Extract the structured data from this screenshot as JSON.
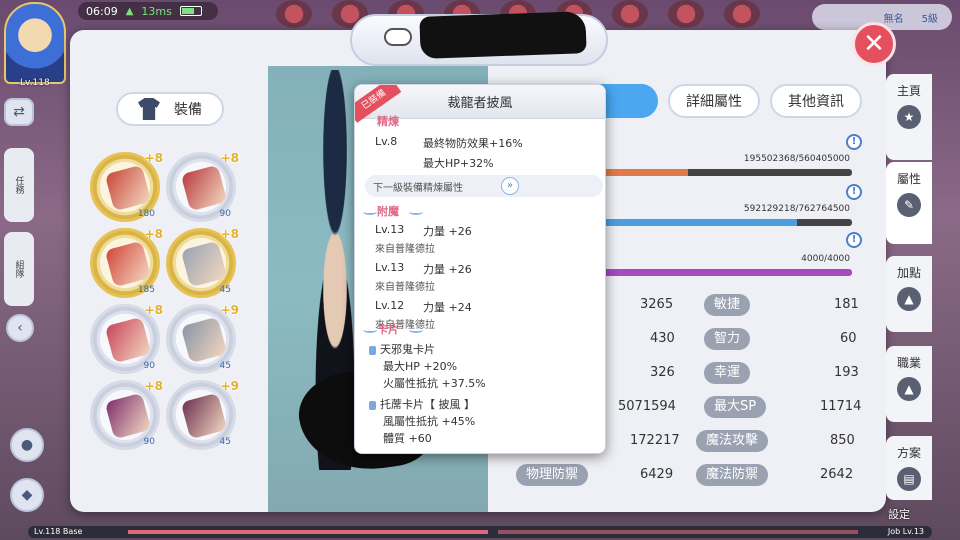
{
  "hud": {
    "avatar_level": "Lv.118",
    "time": "06:09",
    "latency": "13ms",
    "top_right_name": "無名",
    "top_right_tag": "5級"
  },
  "left_side": {
    "team_tab": "組隊",
    "quest_tab": "任務"
  },
  "panel": {
    "equip_header": "裝備",
    "close_label": "✕"
  },
  "equipment_slots": [
    {
      "plus": "+8",
      "count": "180",
      "color": "#c9473a",
      "gold": true
    },
    {
      "plus": "+8",
      "count": "90",
      "color": "#b83a40",
      "gold": false
    },
    {
      "plus": "+8",
      "count": "185",
      "color": "#d2473a",
      "gold": true
    },
    {
      "plus": "+8",
      "count": "45",
      "color": "#9aa3b3",
      "gold": true
    },
    {
      "plus": "+8",
      "count": "90",
      "color": "#c8455a",
      "gold": false
    },
    {
      "plus": "+9",
      "count": "45",
      "color": "#8a93a6",
      "gold": false
    },
    {
      "plus": "+8",
      "count": "90",
      "color": "#7e2f6e",
      "gold": false
    },
    {
      "plus": "+9",
      "count": "45",
      "color": "#6b3050",
      "gold": false
    }
  ],
  "tabs": {
    "detail": "詳細屬性",
    "other": "其他資訊"
  },
  "bars": [
    {
      "value": "195502368/560405000",
      "fill": 0.35,
      "color": "#e07a4a"
    },
    {
      "value": "592129218/762764500",
      "fill": 0.78,
      "color": "#4a9ee0"
    },
    {
      "value": "4000/4000",
      "fill": 1.0,
      "color": "#a64ac0"
    }
  ],
  "stats": {
    "row1_val": "3265",
    "agi_label": "敏捷",
    "agi_val": "181",
    "row2_val": "430",
    "int_label": "智力",
    "int_val": "60",
    "row3_val": "326",
    "luk_label": "幸運",
    "luk_val": "193",
    "row4_val": "5071594",
    "maxsp_label": "最大SP",
    "maxsp_val": "11714",
    "row5_val": "172217",
    "matk_label": "魔法攻擊",
    "matk_val": "850",
    "pdef_label": "物理防禦",
    "pdef_val": "6429",
    "mdef_label": "魔法防禦",
    "mdef_val": "2642"
  },
  "right_nav": {
    "home": "主頁",
    "attr": "屬性",
    "addpoint": "加點",
    "job": "職業",
    "plan": "方案",
    "settings": "設定"
  },
  "tooltip": {
    "equipped_tag": "已裝備",
    "title": "裁龍者披風",
    "refine_section": "精煉",
    "refine_lv": "Lv.8",
    "refine_line1": "最終物防效果+16%",
    "refine_line2": "最大HP+32%",
    "next_refine": "下一級裝備精煉屬性",
    "enchant_section": "附魔",
    "enchants": [
      {
        "lv": "Lv.13",
        "effect": "力量 +26",
        "source": "來自普隆德拉"
      },
      {
        "lv": "Lv.13",
        "effect": "力量 +26",
        "source": "來自普隆德拉"
      },
      {
        "lv": "Lv.12",
        "effect": "力量 +24",
        "source": "來自普隆德拉"
      }
    ],
    "card_section": "卡片",
    "cards": [
      {
        "name": "天邪鬼卡片",
        "lines": [
          "最大HP +20%",
          "火屬性抵抗 +37.5%"
        ]
      },
      {
        "name": "托蓆卡片【 披風 】",
        "lines": [
          "風屬性抵抗 +45%",
          "體質 +60"
        ]
      }
    ]
  },
  "bottom": {
    "base_level": "Lv.118 Base",
    "job_level": "Job Lv.13"
  }
}
